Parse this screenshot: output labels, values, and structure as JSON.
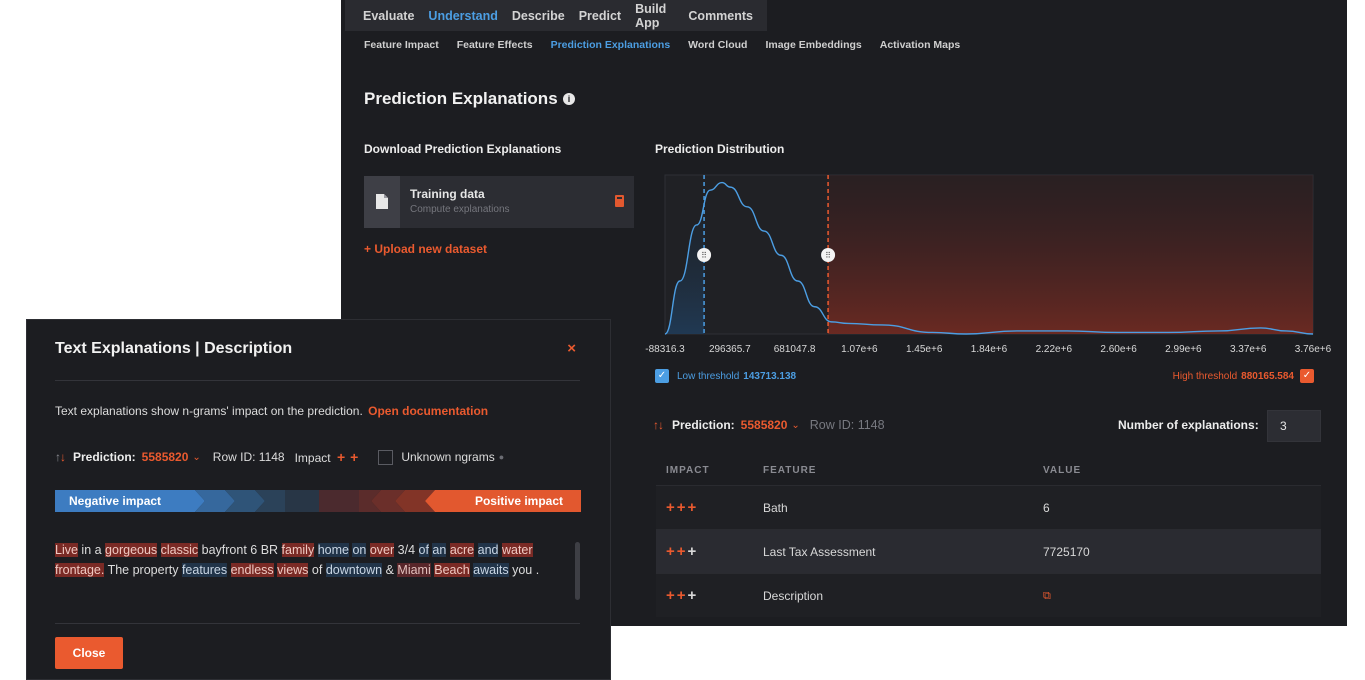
{
  "topnav": [
    "Evaluate",
    "Understand",
    "Describe",
    "Predict",
    "Build App",
    "Comments"
  ],
  "subnav": [
    "Feature Impact",
    "Feature Effects",
    "Prediction Explanations",
    "Word Cloud",
    "Image Embeddings",
    "Activation Maps"
  ],
  "page": {
    "title": "Prediction Explanations"
  },
  "download": {
    "heading": "Download Prediction Explanations",
    "card_title": "Training data",
    "card_sub": "Compute explanations",
    "upload_label": "+ Upload new dataset"
  },
  "distribution": {
    "heading": "Prediction Distribution",
    "low_threshold_label": "Low threshold",
    "low_threshold_value": "143713.138",
    "high_threshold_label": "High threshold",
    "high_threshold_value": "880165.584"
  },
  "chart_data": {
    "type": "area",
    "x_ticks": [
      "-88316.3",
      "296365.7",
      "681047.8",
      "1.07e+6",
      "1.45e+6",
      "1.84e+6",
      "2.22e+6",
      "2.60e+6",
      "2.99e+6",
      "3.37e+6",
      "3.76e+6"
    ],
    "x": [
      -88316.3,
      0,
      100000,
      180000,
      250000,
      300000,
      400000,
      500000,
      600000,
      700000,
      800000,
      900000,
      1000000,
      1200000,
      1500000,
      1700000,
      2000000,
      2300000,
      2600000,
      2900000,
      3200000,
      3450000,
      3600000,
      3760000
    ],
    "density": [
      0.0,
      0.35,
      0.72,
      0.95,
      1.0,
      0.97,
      0.84,
      0.68,
      0.52,
      0.35,
      0.18,
      0.08,
      0.07,
      0.06,
      0.01,
      0.0,
      0.02,
      0.02,
      0.01,
      0.01,
      0.02,
      0.04,
      0.02,
      0.0
    ],
    "xlim": [
      -88316.3,
      3760000
    ],
    "ylim": [
      0,
      1.05
    ],
    "low_threshold": 143713.138,
    "high_threshold": 880165.584
  },
  "prediction": {
    "label": "Prediction:",
    "value": "5585820",
    "row_id": "Row ID: 1148",
    "num_exp_label": "Number of explanations:",
    "num_exp_value": "3"
  },
  "table": {
    "headers": [
      "IMPACT",
      "FEATURE",
      "VALUE"
    ],
    "rows": [
      {
        "plus": [
          true,
          true,
          true
        ],
        "feature": "Bath",
        "value": "6"
      },
      {
        "plus": [
          true,
          true,
          false
        ],
        "feature": "Last Tax Assessment",
        "value": "7725170"
      },
      {
        "plus": [
          true,
          true,
          false
        ],
        "feature": "Description",
        "value": ""
      }
    ]
  },
  "modal": {
    "title": "Text Explanations | Description",
    "close_x": "×",
    "desc": "Text explanations show n-grams' impact on the prediction.",
    "doc_link": "Open documentation",
    "pred_label": "Prediction:",
    "pred_value": "5585820",
    "row_id": "Row ID: 1148",
    "impact_label": "Impact",
    "unknown_label": "Unknown ngrams",
    "neg_label": "Negative impact",
    "pos_label": "Positive impact",
    "close_btn": "Close",
    "text_tokens": [
      {
        "t": "Live",
        "c": "p1"
      },
      {
        "t": " in a ",
        "c": ""
      },
      {
        "t": "gorgeous",
        "c": "p1"
      },
      {
        "t": " ",
        "c": ""
      },
      {
        "t": "classic",
        "c": "p1"
      },
      {
        "t": " bayfront 6 BR ",
        "c": ""
      },
      {
        "t": "family",
        "c": "p1"
      },
      {
        "t": " ",
        "c": ""
      },
      {
        "t": "home",
        "c": "n1"
      },
      {
        "t": " ",
        "c": ""
      },
      {
        "t": "on",
        "c": "n1"
      },
      {
        "t": " ",
        "c": ""
      },
      {
        "t": "over",
        "c": "p1"
      },
      {
        "t": " 3/4 ",
        "c": ""
      },
      {
        "t": "of",
        "c": "n1"
      },
      {
        "t": " ",
        "c": ""
      },
      {
        "t": "an",
        "c": "n1"
      },
      {
        "t": " ",
        "c": ""
      },
      {
        "t": "acre",
        "c": "p1"
      },
      {
        "t": " ",
        "c": ""
      },
      {
        "t": "and",
        "c": "n1"
      },
      {
        "t": " ",
        "c": ""
      },
      {
        "t": "wate",
        "c": "p1"
      },
      {
        "t": "r frontage.",
        "c": "p1"
      },
      {
        "t": " The property ",
        "c": ""
      },
      {
        "t": "features",
        "c": "n1"
      },
      {
        "t": " ",
        "c": ""
      },
      {
        "t": "endless",
        "c": "p1"
      },
      {
        "t": " ",
        "c": ""
      },
      {
        "t": "views",
        "c": "p1"
      },
      {
        "t": " of ",
        "c": ""
      },
      {
        "t": "downtown",
        "c": "n1"
      },
      {
        "t": " & ",
        "c": ""
      },
      {
        "t": "Miami",
        "c": "p2"
      },
      {
        "t": " ",
        "c": ""
      },
      {
        "t": "Beach",
        "c": "p1"
      },
      {
        "t": " ",
        "c": ""
      },
      {
        "t": "awaits",
        "c": "n1"
      },
      {
        "t": " y",
        "c": ""
      },
      {
        "t": "ou .",
        "c": ""
      }
    ]
  },
  "colors": {
    "accent": "#ea5a2f",
    "blue": "#4c9ee3",
    "bg": "#1c1d21"
  }
}
